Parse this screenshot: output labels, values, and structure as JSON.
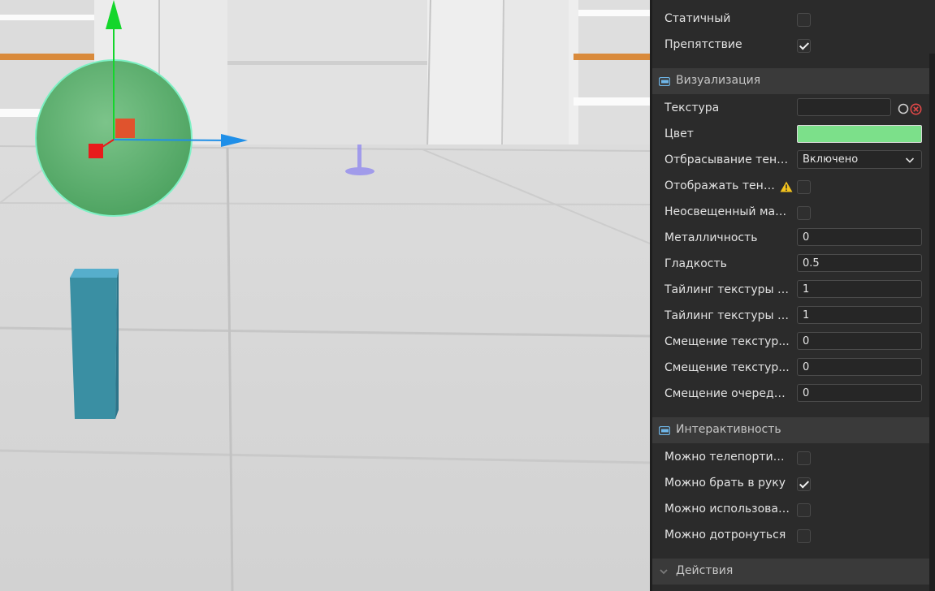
{
  "viewport": {
    "sphere_color": "#5cae6e",
    "cube_color": "#3a8fa3"
  },
  "physics": {
    "static_label": "Статичный",
    "static_checked": false,
    "obstacle_label": "Препятствие",
    "obstacle_checked": true
  },
  "visualization": {
    "section_title": "Визуализация",
    "texture_label": "Текстура",
    "texture_value": "",
    "color_label": "Цвет",
    "color_value": "#7ce08a",
    "shadows_label": "Отбрасывание теней",
    "shadows_value": "Включено",
    "display_shadows_label": "Отображать тени...",
    "display_shadows_checked": false,
    "unlit_label": "Неосвещенный мат...",
    "unlit_checked": false,
    "metallic_label": "Металличность",
    "metallic_value": "0",
    "smoothness_label": "Гладкость",
    "smoothness_value": "0.5",
    "tiling_x_label": "Тайлинг текстуры п...",
    "tiling_x_value": "1",
    "tiling_y_label": "Тайлинг текстуры п...",
    "tiling_y_value": "1",
    "offset_x_label": "Смещение текстур...",
    "offset_x_value": "0",
    "offset_y_label": "Смещение текстур...",
    "offset_y_value": "0",
    "queue_offset_label": "Смещение очереди...",
    "queue_offset_value": "0"
  },
  "interactivity": {
    "section_title": "Интерактивность",
    "teleport_label": "Можно телепортир...",
    "teleport_checked": false,
    "grab_label": "Можно брать в руку",
    "grab_checked": true,
    "use_label": "Можно использовать",
    "use_checked": false,
    "touch_label": "Можно дотронуться",
    "touch_checked": false
  },
  "actions": {
    "section_title": "Действия"
  }
}
